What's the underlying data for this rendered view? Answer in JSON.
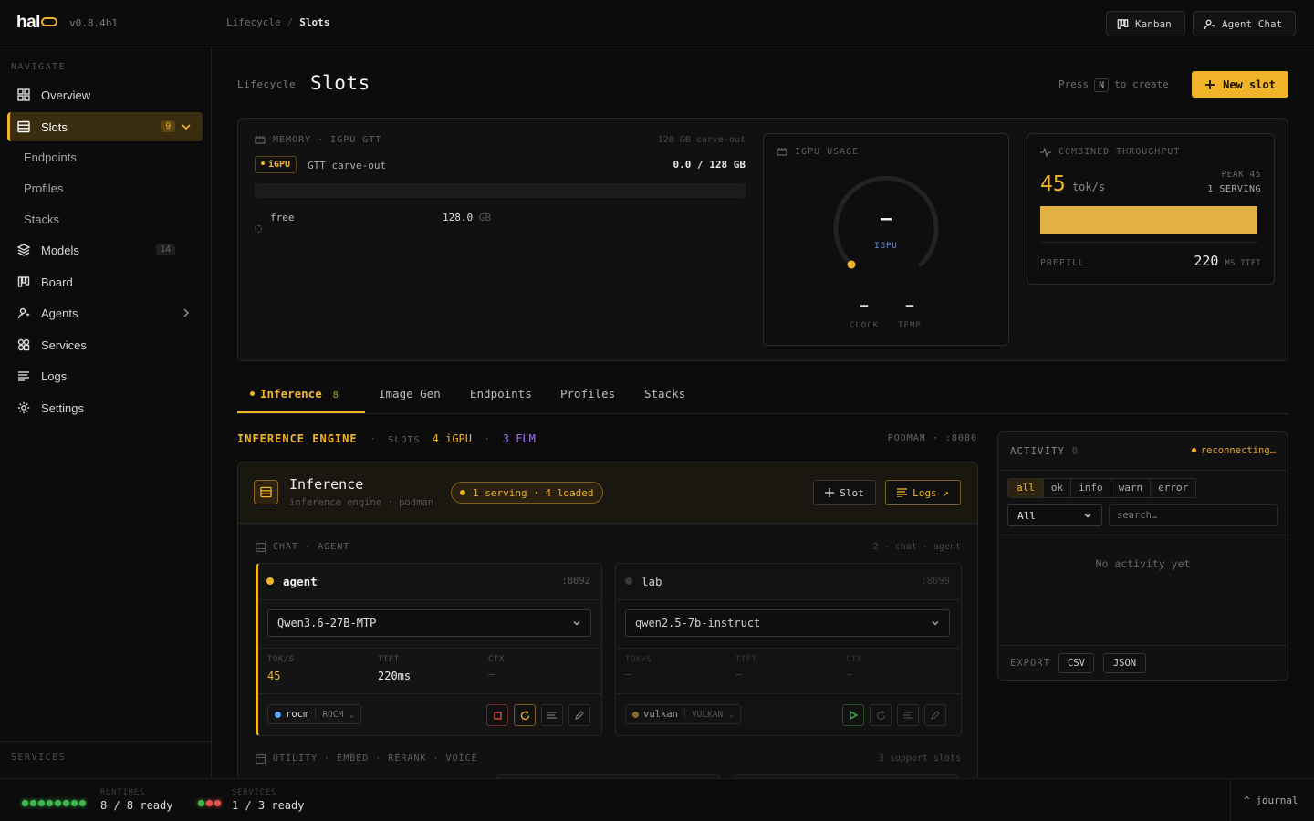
{
  "app": {
    "logo_text": "hal",
    "version": "v0.8.4b1"
  },
  "breadcrumb": {
    "parent": "Lifecycle",
    "separator": "/",
    "current": "Slots"
  },
  "topbar": {
    "kanban_label": "Kanban",
    "agent_chat_label": "Agent Chat"
  },
  "sidebar": {
    "section_label": "NAVIGATE",
    "items": {
      "overview": "Overview",
      "slots": "Slots",
      "slots_count": "9",
      "endpoints": "Endpoints",
      "profiles": "Profiles",
      "stacks": "Stacks",
      "models": "Models",
      "models_count": "14",
      "board": "Board",
      "agents": "Agents",
      "services": "Services",
      "logs": "Logs",
      "settings": "Settings"
    },
    "footer_section_label": "SERVICES"
  },
  "header": {
    "kicker": "Lifecycle",
    "title": "Slots",
    "press_prefix": "Press",
    "press_key": "N",
    "press_suffix": "to create",
    "new_slot_label": "New slot"
  },
  "memory": {
    "label": "MEMORY · IGPU GTT",
    "carve_note": "128 GB carve-out",
    "chip": "iGPU",
    "chip_desc": "GTT carve-out",
    "usage": "0.0 / 128 GB",
    "free_label": "free",
    "free_value": "128.0",
    "free_unit": "GB",
    "used_fraction": 0.0
  },
  "igpu": {
    "label": "IGPU USAGE",
    "value": "—",
    "sub": "IGPU",
    "clock_value": "—",
    "clock_label": "CLOCK",
    "temp_value": "—",
    "temp_label": "TEMP"
  },
  "throughput": {
    "label": "COMBINED THROUGHPUT",
    "value": "45",
    "unit": "tok/s",
    "peak": "PEAK 45",
    "serving": "1 SERVING",
    "prefill_label": "PREFILL",
    "prefill_value": "220",
    "prefill_unit": "MS TTFT",
    "bar_fraction": 1.0
  },
  "tabs": {
    "inference": "Inference",
    "inference_count": "8",
    "image_gen": "Image Gen",
    "endpoints": "Endpoints",
    "profiles": "Profiles",
    "stacks": "Stacks"
  },
  "engine_row": {
    "title": "INFERENCE ENGINE",
    "slots_label": "SLOTS",
    "igpu_count": "4 iGPU",
    "flm_count": "3 FLM",
    "runtime": "PODMAN · :8080"
  },
  "inference_panel": {
    "title": "Inference",
    "subtitle": "inference engine · podman",
    "status": "1 serving · 4 loaded",
    "slot_button": "Slot",
    "logs_button": "Logs ↗",
    "group_label": "CHAT · AGENT",
    "group_note": "2 · chat · agent",
    "utility_label": "UTILITY · EMBED · RERANK · VOICE",
    "utility_note": "3 support slots"
  },
  "slots": [
    {
      "name": "agent",
      "port": ":8092",
      "model": "Qwen3.6-27B-MTP",
      "tok_label": "TOK/S",
      "tok": "45",
      "ttft_label": "TTFT",
      "ttft": "220ms",
      "ctx_label": "CTX",
      "ctx": "—",
      "backend": "rocm",
      "backend_tag": "ROCM"
    },
    {
      "name": "lab",
      "port": ":8099",
      "model": "qwen2.5-7b-instruct",
      "tok_label": "TOK/S",
      "tok": "—",
      "ttft_label": "TTFT",
      "ttft": "—",
      "ctx_label": "CTX",
      "ctx": "—",
      "backend": "vulkan",
      "backend_tag": "VULKAN"
    }
  ],
  "activity": {
    "label": "ACTIVITY",
    "count": "0",
    "status": "reconnecting…",
    "filters": [
      "all",
      "ok",
      "info",
      "warn",
      "error"
    ],
    "select_value": "All",
    "search_placeholder": "search…",
    "empty": "No activity yet",
    "export_label": "EXPORT",
    "csv": "CSV",
    "json": "JSON"
  },
  "footer": {
    "runtimes_label": "RUNTIMES",
    "runtimes_value": "8 / 8 ready",
    "services_label": "SERVICES",
    "services_value": "1 / 3 ready",
    "journal": "^ journal"
  },
  "colors": {
    "accent": "#f0b429",
    "green": "#3fb950",
    "red": "#e5534b",
    "blue": "#58a6ff",
    "purple": "#a371f7"
  }
}
